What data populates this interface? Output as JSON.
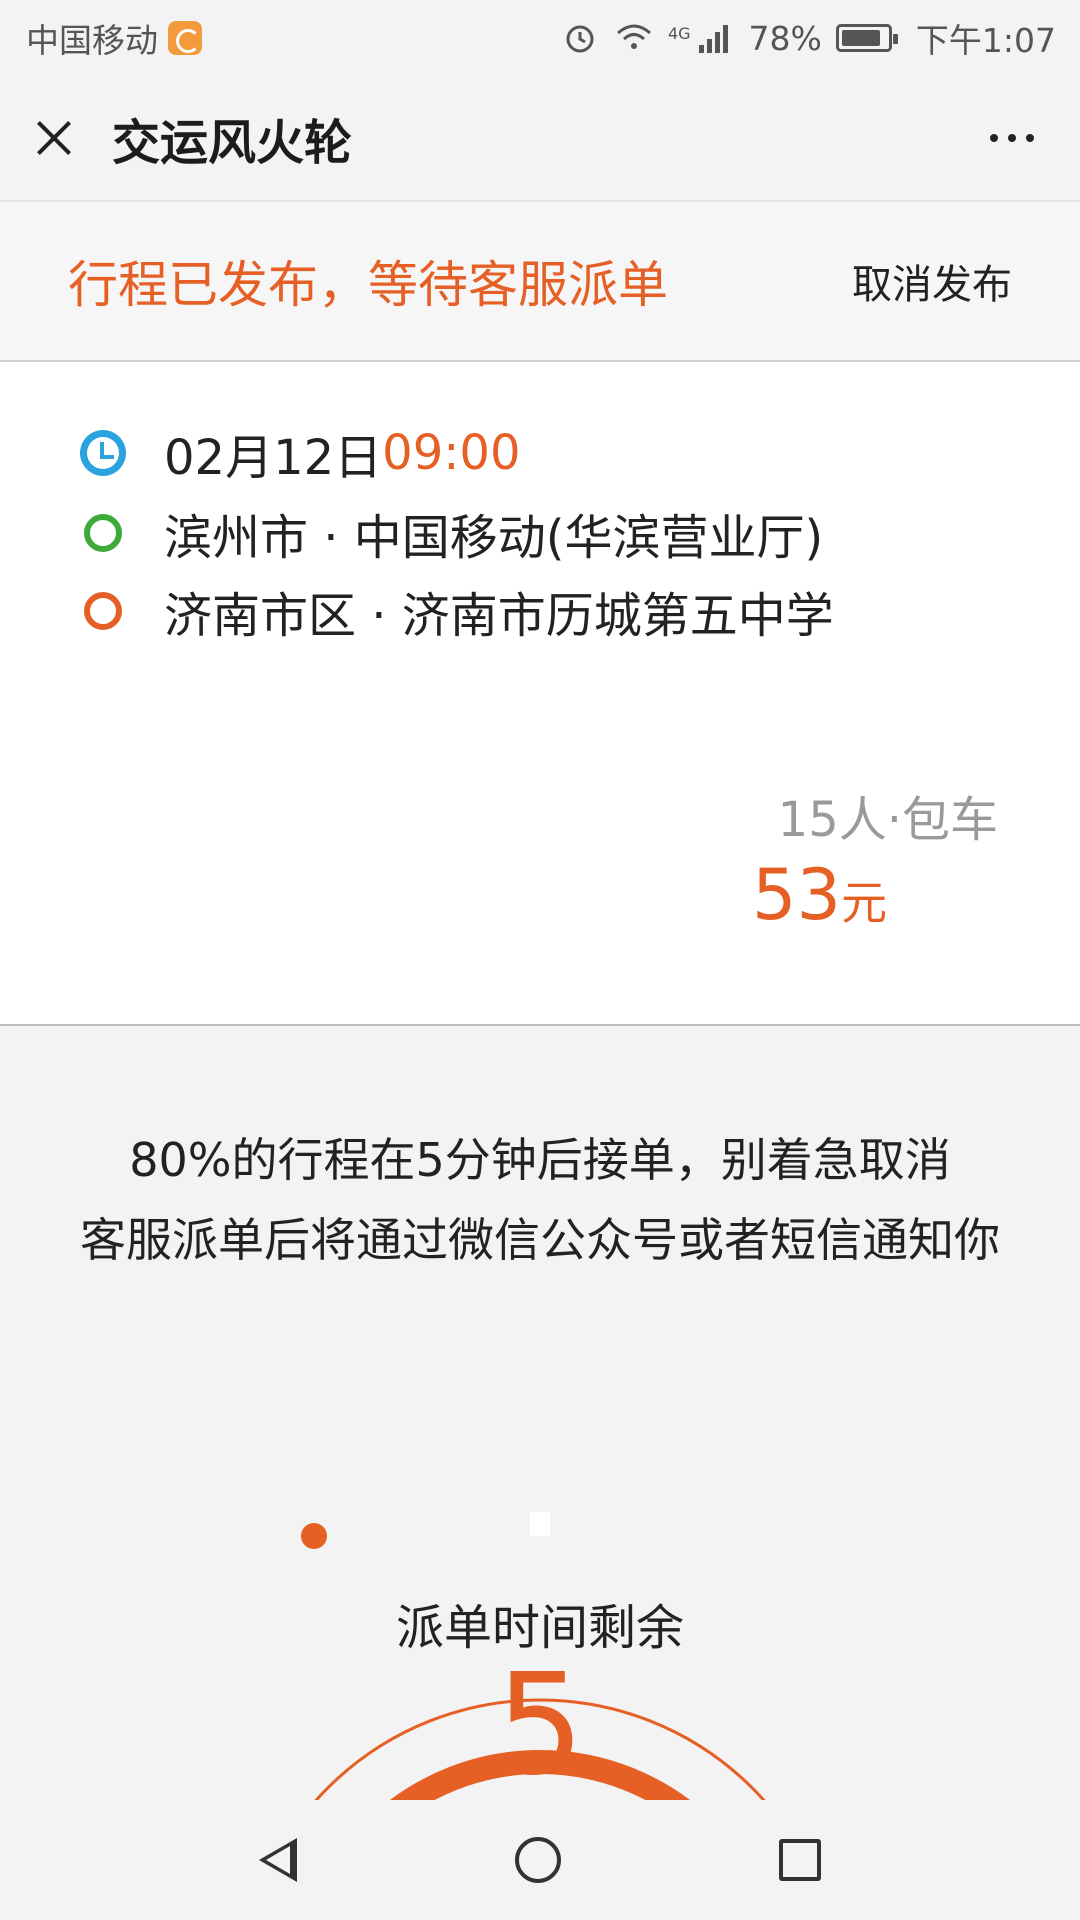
{
  "status_bar": {
    "carrier": "中国移动",
    "network": "4G",
    "battery": "78%",
    "time": "下午1:07"
  },
  "header": {
    "title": "交运风火轮"
  },
  "banner": {
    "status": "行程已发布，等待客服派单",
    "cancel_label": "取消发布"
  },
  "trip": {
    "date": "02月12日",
    "time": "09:00",
    "from": "滨州市 · 中国移动(华滨营业厅)",
    "to": "济南市区 · 济南市历城第五中学",
    "passengers": "15人·包车",
    "price": "53",
    "price_unit": "元"
  },
  "info": {
    "line1": "80%的行程在5分钟后接单，别着急取消",
    "line2": "客服派单后将通过微信公众号或者短信通知你"
  },
  "countdown": {
    "label": "派单时间剩余",
    "value": "5"
  },
  "colors": {
    "accent": "#e65f25",
    "clock_blue": "#2aa3de",
    "start_green": "#3daa3a"
  }
}
